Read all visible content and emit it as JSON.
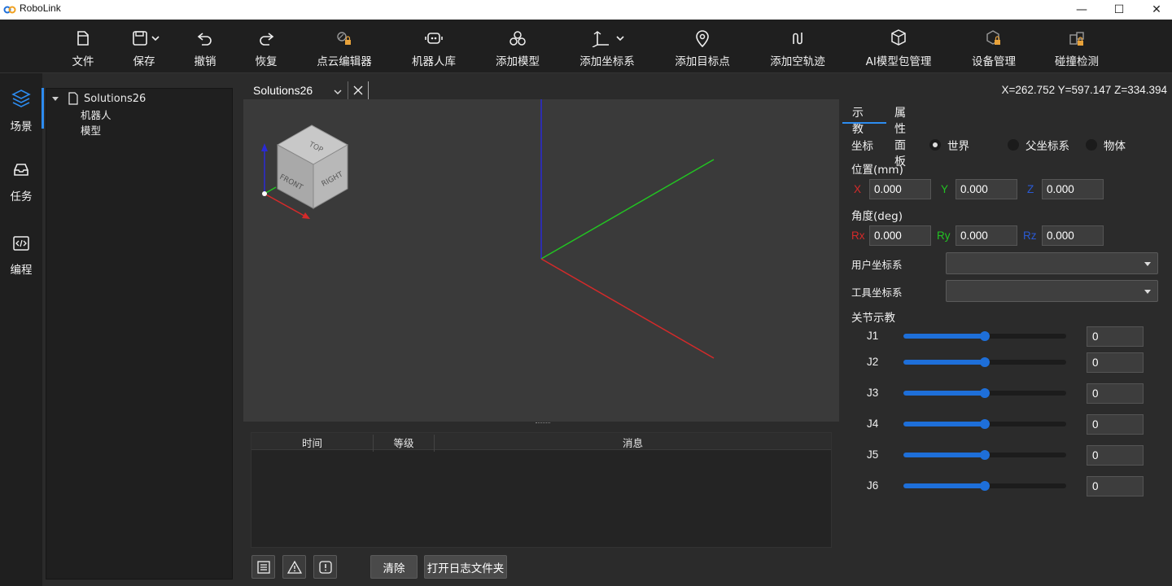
{
  "app": {
    "title": "RoboLink"
  },
  "window_controls": {
    "minimize": "—",
    "maximize": "☐",
    "close": "✕"
  },
  "toolbar": {
    "items": [
      {
        "label": "文件",
        "icon": "file-icon"
      },
      {
        "label": "保存",
        "icon": "save-icon"
      },
      {
        "label": "撤销",
        "icon": "undo-icon"
      },
      {
        "label": "恢复",
        "icon": "redo-icon"
      },
      {
        "label": "点云编辑器",
        "icon": "point-cloud-locked-icon"
      },
      {
        "label": "机器人库",
        "icon": "robot-icon"
      },
      {
        "label": "添加模型",
        "icon": "model-icon"
      },
      {
        "label": "添加坐标系",
        "icon": "frame-icon"
      },
      {
        "label": "添加目标点",
        "icon": "target-icon"
      },
      {
        "label": "添加空轨迹",
        "icon": "path-icon"
      },
      {
        "label": "AI模型包管理",
        "icon": "ai-package-icon"
      },
      {
        "label": "设备管理",
        "icon": "device-locked-icon"
      },
      {
        "label": "碰撞检测",
        "icon": "collision-locked-icon"
      }
    ]
  },
  "rail": {
    "items": [
      {
        "label": "场景",
        "icon": "layers-icon"
      },
      {
        "label": "任务",
        "icon": "inbox-icon"
      },
      {
        "label": "编程",
        "icon": "code-icon"
      }
    ]
  },
  "tree": {
    "root": "Solutions26",
    "children": [
      "机器人",
      "模型"
    ]
  },
  "viewport": {
    "tab_title": "Solutions26",
    "coordinates": "X=262.752  Y=597.147  Z=334.394",
    "cube_faces": {
      "top": "TOP",
      "front": "FRONT",
      "right": "RIGHT"
    }
  },
  "log": {
    "columns": [
      "时间",
      "等级",
      "消息"
    ],
    "clear_label": "清除",
    "open_folder_label": "打开日志文件夹"
  },
  "right_panel": {
    "tabs": [
      "示教",
      "属性面板"
    ],
    "coord_label": "坐标",
    "coord_options": [
      "世界",
      "父坐标系",
      "物体"
    ],
    "position_label": "位置(mm)",
    "angle_label": "角度(deg)",
    "pos": {
      "x_label": "X",
      "y_label": "Y",
      "z_label": "Z",
      "x": "0.000",
      "y": "0.000",
      "z": "0.000"
    },
    "rot": {
      "rx_label": "Rx",
      "ry_label": "Ry",
      "rz_label": "Rz",
      "rx": "0.000",
      "ry": "0.000",
      "rz": "0.000"
    },
    "user_frame_label": "用户坐标系",
    "tool_frame_label": "工具坐标系",
    "joint_label": "关节示教",
    "joints": [
      {
        "name": "J1",
        "value": "0",
        "level": 0.5
      },
      {
        "name": "J2",
        "value": "0",
        "level": 0.5
      },
      {
        "name": "J3",
        "value": "0",
        "level": 0.5
      },
      {
        "name": "J4",
        "value": "0",
        "level": 0.5
      },
      {
        "name": "J5",
        "value": "0",
        "level": 0.5
      },
      {
        "name": "J6",
        "value": "0",
        "level": 0.5
      }
    ]
  },
  "colors": {
    "accent": "#2d8cf0",
    "axis_x": "#d42a2a",
    "axis_y": "#22c322",
    "axis_z": "#2a2ad4"
  }
}
